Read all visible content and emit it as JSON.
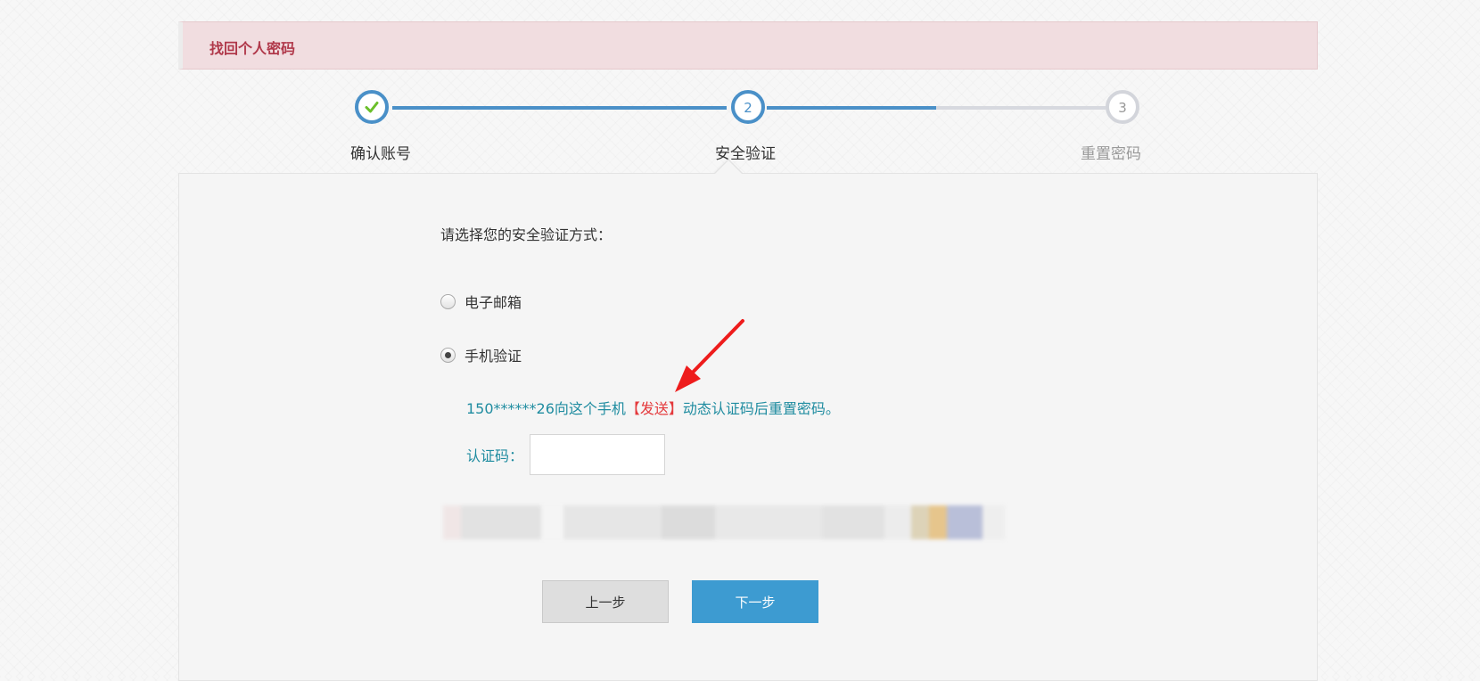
{
  "header": {
    "title": "找回个人密码"
  },
  "steps": [
    {
      "number": "1",
      "label": "确认账号",
      "status": "done"
    },
    {
      "number": "2",
      "label": "安全验证",
      "status": "current"
    },
    {
      "number": "3",
      "label": "重置密码",
      "status": "todo"
    }
  ],
  "form": {
    "prompt": "请选择您的安全验证方式：",
    "options": [
      {
        "label": "电子邮箱",
        "checked": false
      },
      {
        "label": "手机验证",
        "checked": true
      }
    ],
    "send_prefix": "150******26向这个手机",
    "send_link": "【发送】",
    "send_suffix": "动态认证码后重置密码。",
    "code_label": "认证码：",
    "code_value": ""
  },
  "buttons": {
    "prev": "上一步",
    "next": "下一步"
  },
  "icons": {
    "check": "check-icon",
    "annotation": "red-arrow-annotation"
  },
  "colors": {
    "accent": "#4a90c8",
    "header_bg": "#f1dde0",
    "header_text": "#b0384a",
    "link_red": "#e4393c",
    "info_teal": "#1f8ca0",
    "next_button": "#3d9bd1"
  }
}
